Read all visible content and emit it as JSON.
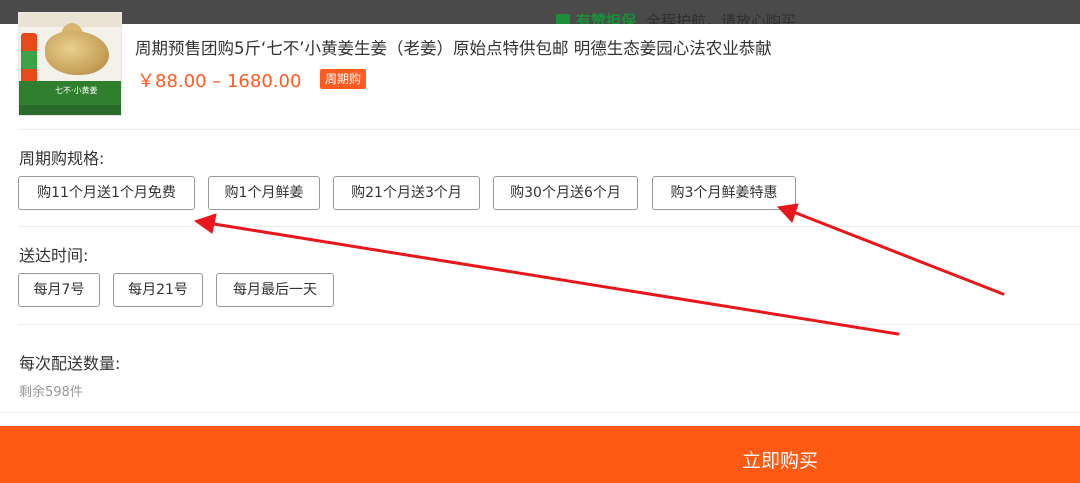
{
  "topbar": {
    "guarantee": "有赞担保",
    "hint": "全程护航，请放心购买"
  },
  "product": {
    "image_text": "七不·小黄姜",
    "title": "周期预售团购5斤‘七不’小黄姜生姜（老姜）原始点特供包邮 明德生态姜园心法农业恭献",
    "price": "￥88.00 – 1680.00",
    "tag": "周期购"
  },
  "sections": {
    "spec_label": "周期购规格:",
    "spec_options": [
      "购11个月送1个月免费",
      "购1个月鲜姜",
      "购21个月送3个月",
      "购30个月送6个月",
      "购3个月鲜姜特惠"
    ],
    "delivery_label": "送达时间:",
    "delivery_options": [
      "每月7号",
      "每月21号",
      "每月最后一天"
    ],
    "quantity_label": "每次配送数量:",
    "stock_text": "剩余598件"
  },
  "actions": {
    "buy_now": "立即购买"
  },
  "colors": {
    "accent": "#ff5a1f",
    "buy_bar": "#ff5a14",
    "arrow": "#e8171b"
  }
}
